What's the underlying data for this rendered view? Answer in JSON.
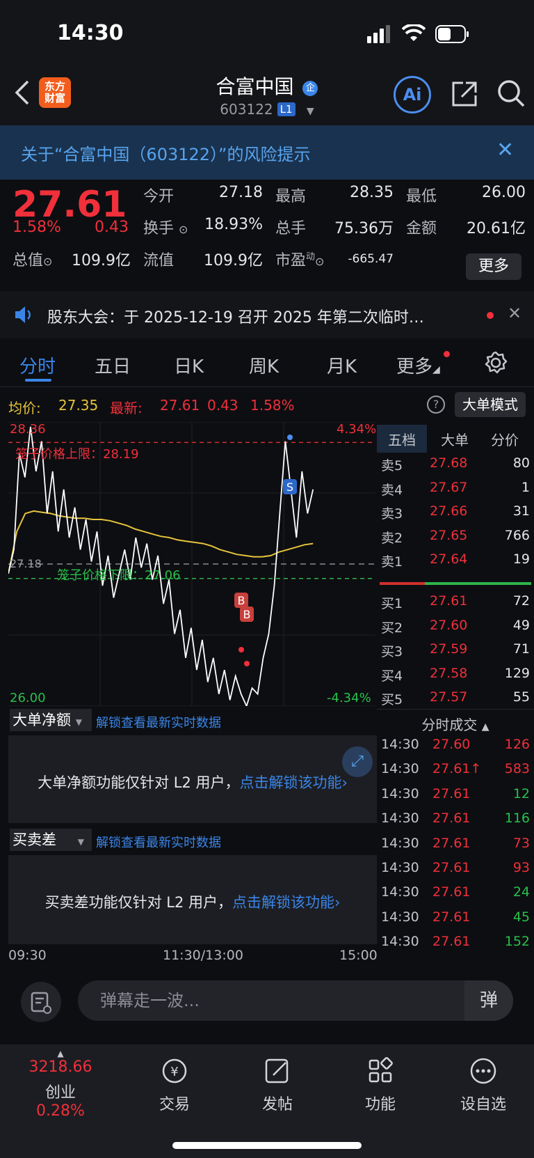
{
  "status": {
    "time": "14:30"
  },
  "header": {
    "logo_text_1": "东方",
    "logo_text_2": "财富",
    "stock_name": "合富中国",
    "stock_code": "603122",
    "level_badge": "L1",
    "ai_label": "Ai"
  },
  "risk_banner": {
    "text": "关于“合富中国（603122）”的风险提示"
  },
  "quote": {
    "price": "27.61",
    "change_pct": "1.58%",
    "change_amt": "0.43",
    "open_label": "今开",
    "open": "27.18",
    "high_label": "最高",
    "high": "28.35",
    "low_label": "最低",
    "low": "26.00",
    "turnover_label": "换手",
    "turnover": "18.93%",
    "volume_label": "总手",
    "volume": "75.36万",
    "amount_label": "金额",
    "amount": "20.61亿",
    "mktcap_label": "总值",
    "mktcap": "109.9亿",
    "float_label": "流值",
    "float": "109.9亿",
    "pe_label": "市盈",
    "pe_sup": "动",
    "pe": "-665.47",
    "more_label": "更多"
  },
  "notice": {
    "text": "股东大会：于 2025-12-19 召开 2025 年第二次临时…"
  },
  "tabs": [
    "分时",
    "五日",
    "日K",
    "周K",
    "月K",
    "更多"
  ],
  "info_row": {
    "avg_label": "均价:",
    "avg": "27.35",
    "latest_label": "最新:",
    "latest": "27.61",
    "latest_chg": "0.43",
    "latest_pct": "1.58%",
    "big_order_mode": "大单模式"
  },
  "chart_data": {
    "type": "line",
    "title": "",
    "x_labels": [
      "09:30",
      "11:30/13:00",
      "15:00"
    ],
    "y_max_label": "28.36",
    "y_min_label": "26.00",
    "pct_max_label": "4.34%",
    "pct_min_label": "-4.34%",
    "prev_close": 27.18,
    "prev_close_label": "27.18",
    "upper_limit_label": "笼子价格上限：28.19",
    "lower_limit_label": "笼子价格下限：27.06",
    "ylim": [
      26.0,
      28.36
    ],
    "series": [
      {
        "name": "",
        "color": "#ffffff",
        "values": [
          27.1,
          27.3,
          28.1,
          27.9,
          28.32,
          27.95,
          28.2,
          27.6,
          27.95,
          27.45,
          27.8,
          27.4,
          27.65,
          27.3,
          27.55,
          27.2,
          27.45,
          27.0,
          27.25,
          26.9,
          27.1,
          27.3,
          27.05,
          27.4,
          27.15,
          27.35,
          27.05,
          27.25,
          26.85,
          27.05,
          26.6,
          26.8,
          26.4,
          26.65,
          26.3,
          26.55,
          26.2,
          26.4,
          26.1,
          26.3,
          26.05,
          26.25,
          26.1,
          26.0,
          26.15,
          26.1,
          26.4,
          26.6,
          27.0,
          27.6,
          28.2,
          27.8,
          27.4,
          27.95,
          27.6,
          27.8
        ]
      },
      {
        "name": "",
        "color": "#e6c43c",
        "values": [
          27.1,
          27.45,
          27.6,
          27.62,
          27.61,
          27.6,
          27.58,
          27.57,
          27.56,
          27.56,
          27.55,
          27.55,
          27.54,
          27.52,
          27.5,
          27.47,
          27.45,
          27.43,
          27.41,
          27.4,
          27.38,
          27.37,
          27.36,
          27.35,
          27.33,
          27.3,
          27.28,
          27.26,
          27.25,
          27.24,
          27.24,
          27.25,
          27.28,
          27.3,
          27.32,
          27.34,
          27.35
        ]
      }
    ],
    "markers": [
      "B",
      "B",
      "S"
    ]
  },
  "order_book": {
    "tabs": [
      "五档",
      "大单",
      "分价"
    ],
    "asks": [
      {
        "label": "卖5",
        "price": "27.68",
        "vol": "80"
      },
      {
        "label": "卖4",
        "price": "27.67",
        "vol": "1"
      },
      {
        "label": "卖3",
        "price": "27.66",
        "vol": "31"
      },
      {
        "label": "卖2",
        "price": "27.65",
        "vol": "766"
      },
      {
        "label": "卖1",
        "price": "27.64",
        "vol": "19"
      }
    ],
    "bids": [
      {
        "label": "买1",
        "price": "27.61",
        "vol": "72"
      },
      {
        "label": "买2",
        "price": "27.60",
        "vol": "49"
      },
      {
        "label": "买3",
        "price": "27.59",
        "vol": "71"
      },
      {
        "label": "买4",
        "price": "27.58",
        "vol": "129"
      },
      {
        "label": "买5",
        "price": "27.57",
        "vol": "55"
      }
    ]
  },
  "trades": {
    "title": "分时成交",
    "rows": [
      {
        "time": "14:30",
        "price": "27.60",
        "vol": "126",
        "color": "red"
      },
      {
        "time": "14:30",
        "price": "27.61↑",
        "vol": "583",
        "color": "red"
      },
      {
        "time": "14:30",
        "price": "27.61",
        "vol": "12",
        "color": "green"
      },
      {
        "time": "14:30",
        "price": "27.61",
        "vol": "116",
        "color": "green"
      },
      {
        "time": "14:30",
        "price": "27.61",
        "vol": "73",
        "color": "red"
      },
      {
        "time": "14:30",
        "price": "27.61",
        "vol": "93",
        "color": "red"
      },
      {
        "time": "14:30",
        "price": "27.61",
        "vol": "24",
        "color": "green"
      },
      {
        "time": "14:30",
        "price": "27.61",
        "vol": "45",
        "color": "green"
      },
      {
        "time": "14:30",
        "price": "27.61",
        "vol": "152",
        "color": "green"
      }
    ]
  },
  "panels": {
    "net_title": "大单净额",
    "net_link": "解锁查看最新实时数据",
    "net_msg": "大单净额功能仅针对 L2 用户，",
    "net_msg_link": "点击解锁该功能",
    "spread_title": "买卖差",
    "spread_link": "解锁查看最新实时数据",
    "spread_msg": "买卖差功能仅针对 L2 用户，",
    "spread_msg_link": "点击解锁该功能"
  },
  "danmaku": {
    "placeholder": "弹幕走一波...",
    "btn": "弹"
  },
  "bottom_nav": {
    "index_value": "3218.66",
    "index_name": "创业",
    "index_pct": "0.28%",
    "items": [
      "交易",
      "发帖",
      "功能",
      "设自选"
    ]
  },
  "colors": {
    "up": "#f0303a",
    "down": "#27c04a",
    "accent": "#3a86e8",
    "avg_line": "#e6c43c"
  }
}
